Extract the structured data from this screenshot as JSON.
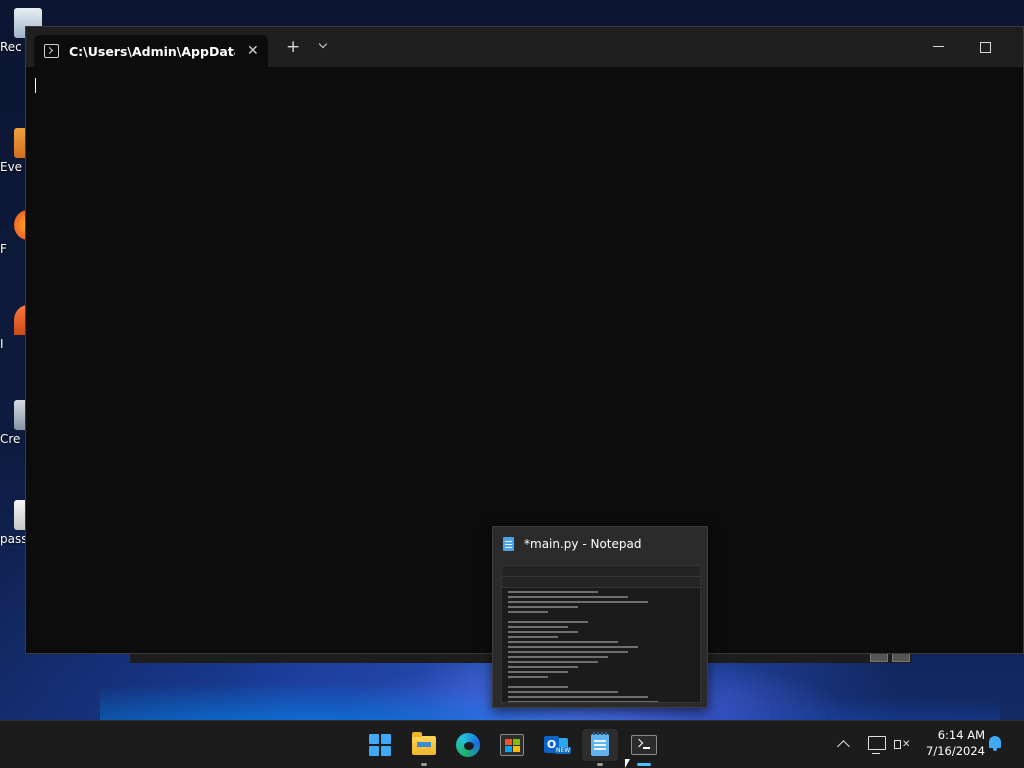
{
  "desktop": {
    "icons": [
      {
        "id": "recycle-bin",
        "label": "Rec"
      },
      {
        "id": "everything",
        "label": "Eve"
      },
      {
        "id": "firefox",
        "label": "F"
      },
      {
        "id": "app-4",
        "label": "I"
      },
      {
        "id": "create",
        "label": "Cre"
      },
      {
        "id": "passwords",
        "label": "pass"
      }
    ]
  },
  "terminal": {
    "tab_title": "C:\\Users\\Admin\\AppData\\Loc",
    "tab_close": "✕",
    "new_tab": "+",
    "content": ""
  },
  "thumbnail": {
    "title": "*main.py - Notepad"
  },
  "taskbar": {
    "apps": [
      {
        "name": "Start",
        "icon": "windows-logo-icon"
      },
      {
        "name": "File Explorer",
        "icon": "folder-icon"
      },
      {
        "name": "Microsoft Edge",
        "icon": "edge-icon"
      },
      {
        "name": "Microsoft Store",
        "icon": "store-icon"
      },
      {
        "name": "Outlook (new)",
        "icon": "outlook-icon",
        "badge": "NEW"
      },
      {
        "name": "Notepad",
        "icon": "notepad-icon",
        "active": true
      },
      {
        "name": "Terminal",
        "icon": "terminal-icon",
        "running": true
      }
    ],
    "clock": {
      "time": "6:14 AM",
      "date": "7/16/2024"
    }
  },
  "colors": {
    "accent": "#4cc2ff",
    "terminal_bg": "#0c0c0c",
    "taskbar_bg": "#1c1c1c"
  }
}
